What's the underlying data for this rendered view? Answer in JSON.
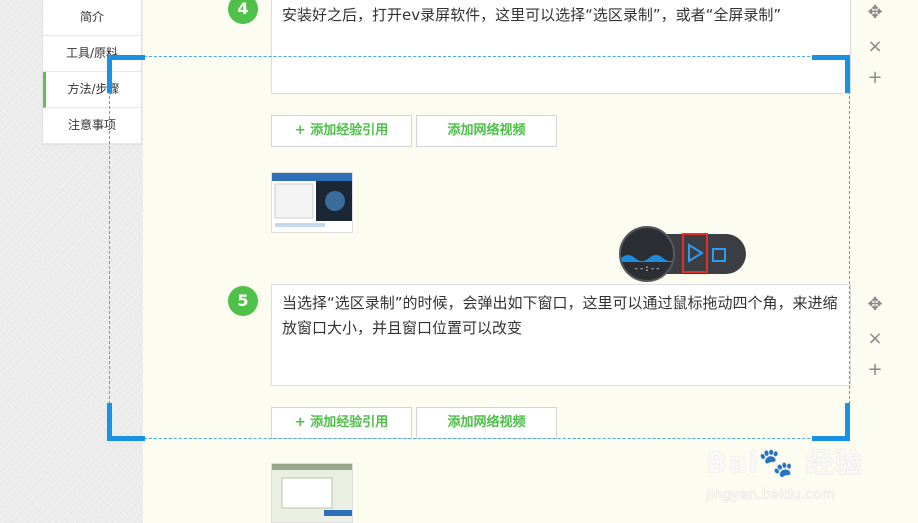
{
  "sidebar": {
    "items": [
      {
        "label": "简介"
      },
      {
        "label": "工具/原料"
      },
      {
        "label": "方法/步骤"
      },
      {
        "label": "注意事项"
      }
    ],
    "active_index": 2
  },
  "steps": [
    {
      "number": "4",
      "text": "安装好之后，打开ev录屏软件，这里可以选择“选区录制”，或者“全屏录制”",
      "add_reference_label": "+ 添加经验引用",
      "add_video_label": "添加网络视频"
    },
    {
      "number": "5",
      "text": "当选择“选区录制”的时候，会弹出如下窗口，这里可以通过鼠标拖动四个角，来进缩放窗口大小，并且窗口位置可以改变",
      "add_reference_label": "+ 添加经验引用",
      "add_video_label": "添加网络视频"
    }
  ],
  "side_controls": {
    "move_icon": "move-icon",
    "delete_icon": "close-icon",
    "add_icon": "plus-icon"
  },
  "recorder": {
    "timer": "--:--",
    "play_icon": "play-icon",
    "stop_icon": "stop-icon",
    "accent_color": "#1792e5",
    "highlight_color": "#e03030"
  },
  "watermark": {
    "logo": "Bai🐾 经验",
    "url": "jingyan.baidu.com"
  },
  "colors": {
    "step_badge": "#4fc04a",
    "button_text": "#4fbf4a",
    "selection_border": "#1792e5"
  }
}
